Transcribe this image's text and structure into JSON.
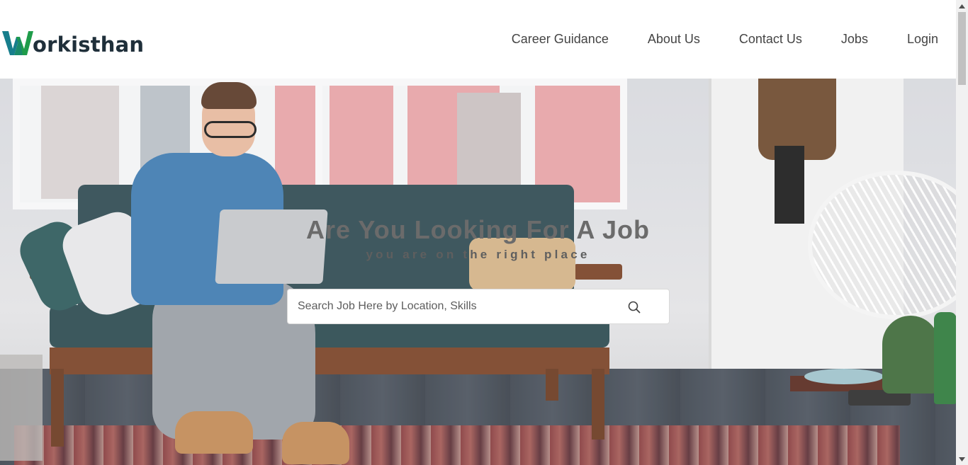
{
  "header": {
    "logo_text": "orkisthan",
    "logo_letter": "W",
    "nav": [
      {
        "label": "Career Guidance"
      },
      {
        "label": "About Us"
      },
      {
        "label": "Contact Us"
      },
      {
        "label": "Jobs"
      },
      {
        "label": "Login"
      }
    ]
  },
  "hero": {
    "headline": "Are You Looking For A Job",
    "subline": "you are on the right place"
  },
  "search": {
    "placeholder": "Search Job Here by Location, Skills",
    "value": "",
    "icon": "search-icon"
  },
  "colors": {
    "logo_green": "#1f9c4a",
    "logo_teal": "#177e8c",
    "logo_text": "#1f2f3a",
    "nav_text": "#444444",
    "headline": "#6b6b6b"
  }
}
